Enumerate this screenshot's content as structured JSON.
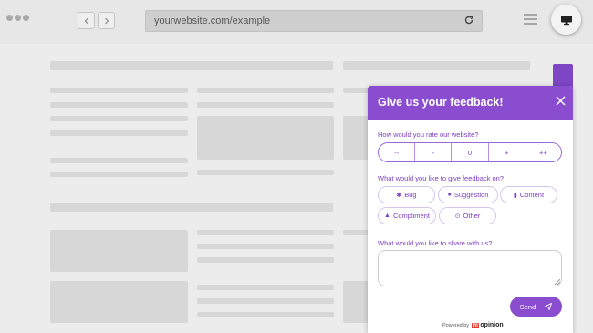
{
  "browser": {
    "url": "yourwebsite.com/example"
  },
  "feedback": {
    "title": "Give us your feedback!",
    "rating_question": "How would you rate our website?",
    "rating_options": [
      "--",
      "-",
      "0",
      "+",
      "++"
    ],
    "type_question": "What would you like to give feedback on?",
    "types": [
      {
        "label": "Bug",
        "icon": "bug-icon"
      },
      {
        "label": "Suggestion",
        "icon": "speech-bubble-icon"
      },
      {
        "label": "Content",
        "icon": "document-icon"
      },
      {
        "label": "Compliment",
        "icon": "thumbs-up-icon"
      },
      {
        "label": "Other",
        "icon": "circle-dot-icon"
      }
    ],
    "share_question": "What would you like to share with us?",
    "comment_value": "",
    "send_label": "Send",
    "powered_by": "Powered by",
    "brand": "opinion",
    "brand_initial": "m"
  },
  "colors": {
    "accent": "#8a4dd0",
    "accent_text": "#7d3fc4",
    "brand_red": "#e33b2e"
  }
}
